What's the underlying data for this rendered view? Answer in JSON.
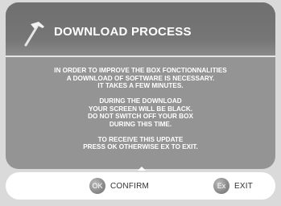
{
  "dialog": {
    "title": "DOWNLOAD PROCESS",
    "icon": "hammer-icon",
    "colors": {
      "background": "#dadada",
      "panel": "#949494",
      "header": "#767676",
      "text": "#ffffff"
    }
  },
  "message": {
    "lines": [
      "IN ORDER TO IMPROVE THE BOX FONCTIONNALITIES",
      "A DOWNLOAD OF SOFTWARE IS NECESSARY.",
      "IT TAKES A FEW MINUTES.",
      "",
      "DURING THE DOWNLOAD",
      "YOUR SCREEN WILL BE BLACK.",
      "DO NOT SWITCH OFF YOUR BOX",
      "DURING THIS TIME.",
      "",
      "TO RECEIVE THIS UPDATE",
      "PRESS OK OTHERWISE EX TO EXIT."
    ]
  },
  "actions": {
    "confirm": {
      "key": "OK",
      "label": "CONFIRM"
    },
    "exit": {
      "key": "Ex",
      "label": "EXIT"
    }
  }
}
